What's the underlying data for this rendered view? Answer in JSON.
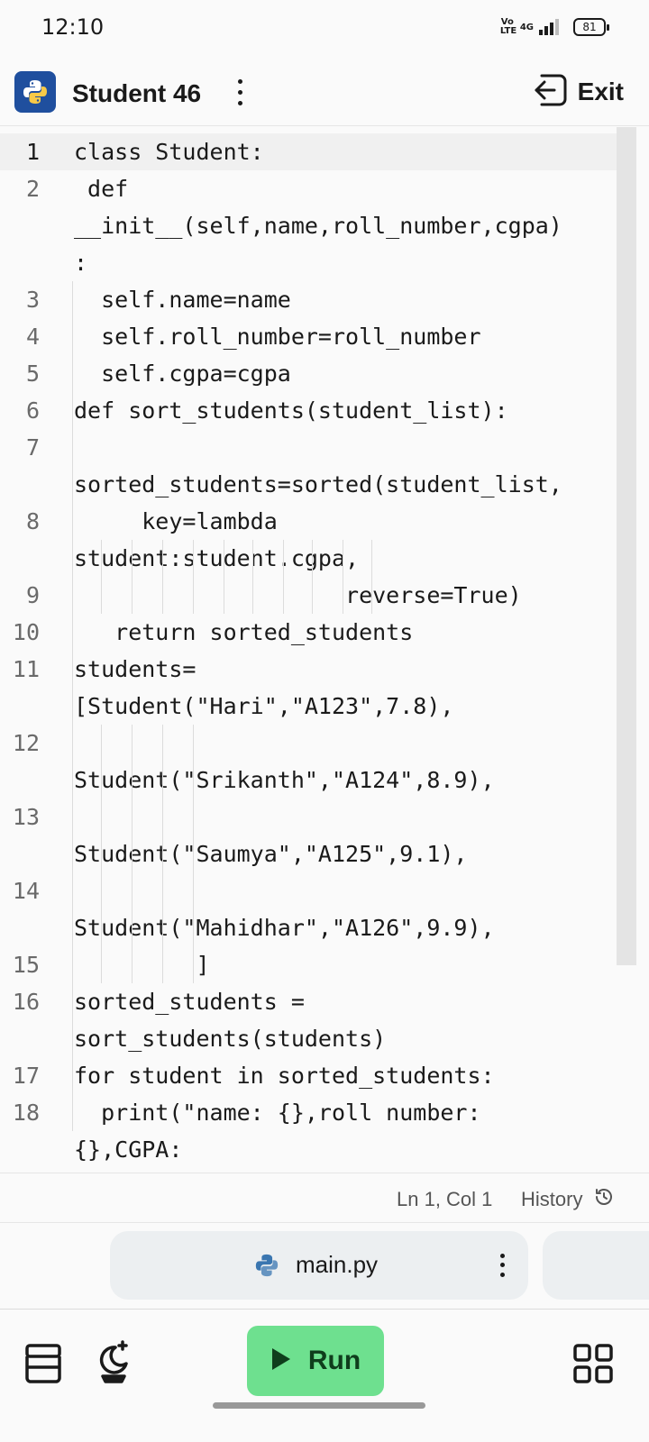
{
  "status_bar": {
    "time": "12:10",
    "volte": "Vo LTE",
    "network": "4G",
    "battery": "81"
  },
  "header": {
    "title": "Student 46",
    "exit_label": "Exit",
    "logo_icon": "python-logo"
  },
  "editor": {
    "current_line": 1,
    "lines": [
      {
        "n": "1",
        "text": "class Student:"
      },
      {
        "n": "2",
        "text": " def"
      },
      {
        "n": "",
        "text": "__init__(self,name,roll_number,cgpa)"
      },
      {
        "n": "",
        "text": ":"
      },
      {
        "n": "3",
        "text": "  self.name=name"
      },
      {
        "n": "4",
        "text": "  self.roll_number=roll_number"
      },
      {
        "n": "5",
        "text": "  self.cgpa=cgpa"
      },
      {
        "n": "6",
        "text": "def sort_students(student_list):"
      },
      {
        "n": "7",
        "text": ""
      },
      {
        "n": "",
        "text": "sorted_students=sorted(student_list,"
      },
      {
        "n": "8",
        "text": "     key=lambda"
      },
      {
        "n": "",
        "text": "student:student.cgpa,"
      },
      {
        "n": "9",
        "text": "                    reverse=True)"
      },
      {
        "n": "10",
        "text": "   return sorted_students"
      },
      {
        "n": "11",
        "text": "students="
      },
      {
        "n": "",
        "text": "[Student(\"Hari\",\"A123\",7.8),"
      },
      {
        "n": "12",
        "text": ""
      },
      {
        "n": "",
        "text": "Student(\"Srikanth\",\"A124\",8.9),"
      },
      {
        "n": "13",
        "text": ""
      },
      {
        "n": "",
        "text": "Student(\"Saumya\",\"A125\",9.1),"
      },
      {
        "n": "14",
        "text": ""
      },
      {
        "n": "",
        "text": "Student(\"Mahidhar\",\"A126\",9.9),"
      },
      {
        "n": "15",
        "text": "         ]"
      },
      {
        "n": "16",
        "text": "sorted_students ="
      },
      {
        "n": "",
        "text": "sort_students(students)"
      },
      {
        "n": "17",
        "text": "for student in sorted_students:"
      },
      {
        "n": "18",
        "text": "  print(\"name: {},roll number:"
      },
      {
        "n": "",
        "text": "{},CGPA:"
      }
    ]
  },
  "editor_footer": {
    "cursor_position": "Ln 1, Col 1",
    "history_label": "History"
  },
  "file_tab": {
    "name": "main.py"
  },
  "bottom_bar": {
    "run_label": "Run"
  },
  "colors": {
    "run_button": "#6ee08f",
    "logo_bg": "#1f4f9e",
    "python_blue": "#3a76b0",
    "python_yellow": "#f7c948"
  }
}
